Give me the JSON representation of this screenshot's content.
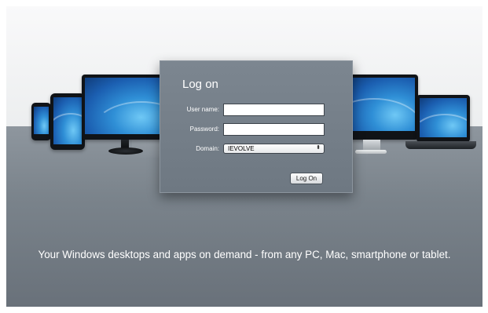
{
  "logon": {
    "title": "Log on",
    "username": {
      "label": "User name:",
      "value": ""
    },
    "password": {
      "label": "Password:",
      "value": ""
    },
    "domain": {
      "label": "Domain:",
      "selected": "IEVOLVE"
    },
    "button_label": "Log On"
  },
  "tagline": "Your Windows desktops and apps on demand - from any PC, Mac, smartphone or tablet.",
  "colors": {
    "panel": "#76808a",
    "floor": "#7a838b",
    "screen_accent": "#2f8fd6"
  },
  "icons": {
    "select_arrow": "updown-chevron-icon"
  }
}
